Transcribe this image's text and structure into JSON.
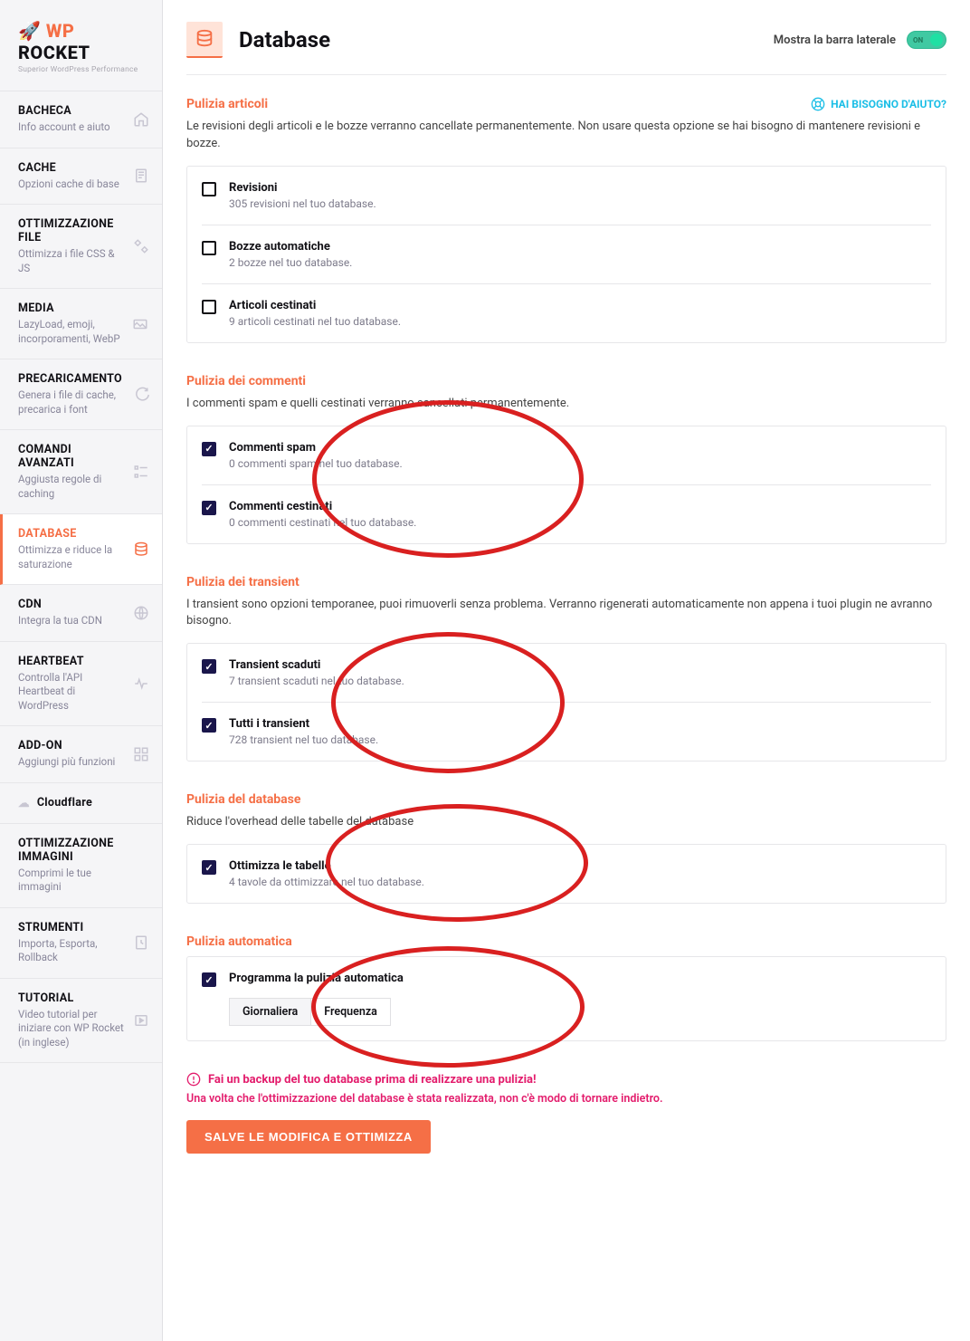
{
  "logo": {
    "prefix": "WP ",
    "suffix": "ROCKET",
    "tagline": "Superior WordPress Performance"
  },
  "nav": [
    {
      "title": "BACHECA",
      "desc": "Info account e aiuto",
      "active": false
    },
    {
      "title": "CACHE",
      "desc": "Opzioni cache di base",
      "active": false
    },
    {
      "title": "OTTIMIZZAZIONE FILE",
      "desc": "Ottimizza i file CSS & JS",
      "active": false
    },
    {
      "title": "MEDIA",
      "desc": "LazyLoad, emoji, incorporamenti, WebP",
      "active": false
    },
    {
      "title": "PRECARICAMENTO",
      "desc": "Genera i file di cache, precarica i font",
      "active": false
    },
    {
      "title": "COMANDI AVANZATI",
      "desc": "Aggiusta regole di caching",
      "active": false
    },
    {
      "title": "DATABASE",
      "desc": "Ottimizza e riduce la saturazione",
      "active": true
    },
    {
      "title": "CDN",
      "desc": "Integra la tua CDN",
      "active": false
    },
    {
      "title": "HEARTBEAT",
      "desc": "Controlla l'API Heartbeat di WordPress",
      "active": false
    },
    {
      "title": "ADD-ON",
      "desc": "Aggiungi più funzioni",
      "active": false
    },
    {
      "title": "Cloudflare",
      "desc": "",
      "active": false,
      "cloudflare": true
    },
    {
      "title": "OTTIMIZZAZIONE IMMAGINI",
      "desc": "Comprimi le tue immagini",
      "active": false
    },
    {
      "title": "STRUMENTI",
      "desc": "Importa, Esporta, Rollback",
      "active": false
    },
    {
      "title": "TUTORIAL",
      "desc": "Video tutorial per iniziare con WP Rocket (in inglese)",
      "active": false
    }
  ],
  "header": {
    "title": "Database",
    "sidebar_toggle_label": "Mostra la barra laterale",
    "switch_text": "ON"
  },
  "help_link": "HAI BISOGNO D'AIUTO?",
  "sections": {
    "posts": {
      "title": "Pulizia articoli",
      "desc": "Le revisioni degli articoli e le bozze verranno cancellate permanentemente. Non usare questa opzione se hai bisogno di mantenere revisioni e bozze.",
      "items": [
        {
          "label": "Revisioni",
          "info": "305 revisioni nel tuo database.",
          "checked": false
        },
        {
          "label": "Bozze automatiche",
          "info": "2 bozze nel tuo database.",
          "checked": false
        },
        {
          "label": "Articoli cestinati",
          "info": "9 articoli cestinati nel tuo database.",
          "checked": false
        }
      ]
    },
    "comments": {
      "title": "Pulizia dei commenti",
      "desc": "I commenti spam e quelli cestinati verranno cancellati permanentemente.",
      "items": [
        {
          "label": "Commenti spam",
          "info": "0 commenti spam nel tuo database.",
          "checked": true
        },
        {
          "label": "Commenti cestinati",
          "info": "0 commenti cestinati nel tuo database.",
          "checked": true
        }
      ]
    },
    "transients": {
      "title": "Pulizia dei transient",
      "desc": "I transient sono opzioni temporanee, puoi rimuoverli senza problema. Verranno rigenerati automaticamente non appena i tuoi plugin ne avranno bisogno.",
      "items": [
        {
          "label": "Transient scaduti",
          "info": "7 transient scaduti nel tuo database.",
          "checked": true
        },
        {
          "label": "Tutti i transient",
          "info": "728 transient nel tuo database.",
          "checked": true
        }
      ]
    },
    "database": {
      "title": "Pulizia del database",
      "desc": "Riduce l'overhead delle tabelle del database",
      "items": [
        {
          "label": "Ottimizza le tabelle",
          "info": "4 tavole da ottimizzare nel tuo database.",
          "checked": true
        }
      ]
    },
    "auto": {
      "title": "Pulizia automatica",
      "item": {
        "label": "Programma la pulizia automatica",
        "checked": true
      },
      "schedule": {
        "value": "Giornaliera",
        "label": "Frequenza"
      }
    }
  },
  "warning": {
    "line1": "Fai un backup del tuo database prima di realizzare una pulizia!",
    "line2": "Una volta che l'ottimizzazione del database è stata realizzata, non c'è modo di tornare indietro."
  },
  "save_button": "SALVE LE MODIFICA E OTTIMIZZA"
}
